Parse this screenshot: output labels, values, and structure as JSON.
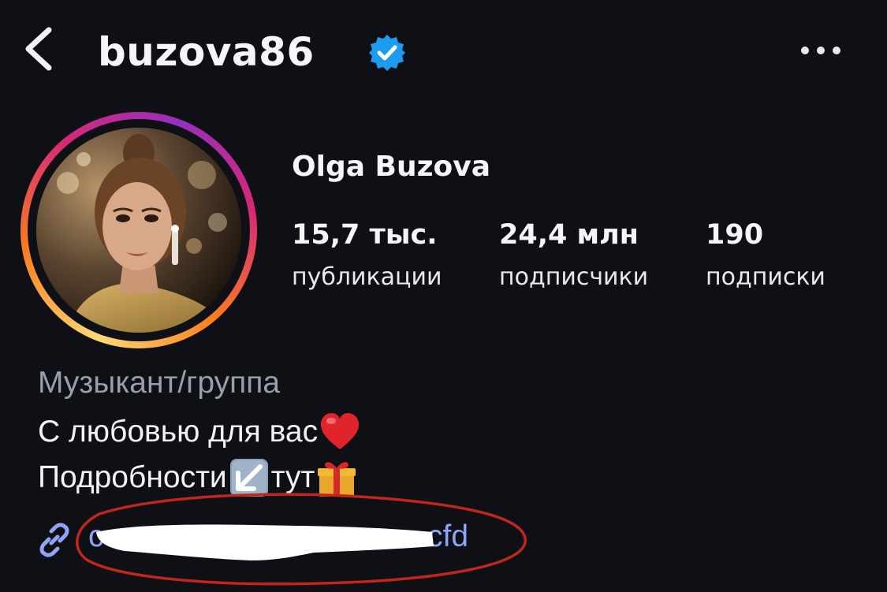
{
  "header": {
    "username": "buzova86",
    "back_icon": "chevron-left-icon",
    "verified_icon": "verified-badge-icon",
    "more_icon": "more-horizontal-icon"
  },
  "profile": {
    "display_name": "Olga Buzova",
    "avatar": "profile-avatar"
  },
  "stats": [
    {
      "value": "15,7 тыс.",
      "label": "публикации"
    },
    {
      "value": "24,4 млн",
      "label": "подписчики"
    },
    {
      "value": "190",
      "label": "подписки"
    }
  ],
  "bio": {
    "category": "Музыкант/группа",
    "line1_text": "С любовью для вас",
    "line1_emoji": "heart-icon",
    "line2_text_a": "Подробности",
    "line2_emoji_a": "arrow-down-left-icon",
    "line2_text_b": "тут",
    "line2_emoji_b": "gift-icon"
  },
  "link": {
    "icon": "link-icon",
    "visible_suffix": "cfd"
  },
  "colors": {
    "background": "#0e1015",
    "link": "#8fa4f5",
    "verified": "#1d9bf0",
    "annotation": "#c0261c",
    "category": "#9a9ea8"
  }
}
